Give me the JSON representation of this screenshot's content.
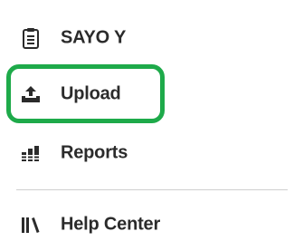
{
  "menu": {
    "items": [
      {
        "label": "SAYO Y",
        "icon": "clipboard-icon"
      },
      {
        "label": "Upload",
        "icon": "upload-tray-icon"
      },
      {
        "label": "Reports",
        "icon": "bar-chart-icon"
      },
      {
        "label": "Help Center",
        "icon": "library-icon"
      }
    ]
  },
  "colors": {
    "highlight": "#1eaa4a",
    "text": "#2b2b2b",
    "divider": "#cfcfcf"
  }
}
